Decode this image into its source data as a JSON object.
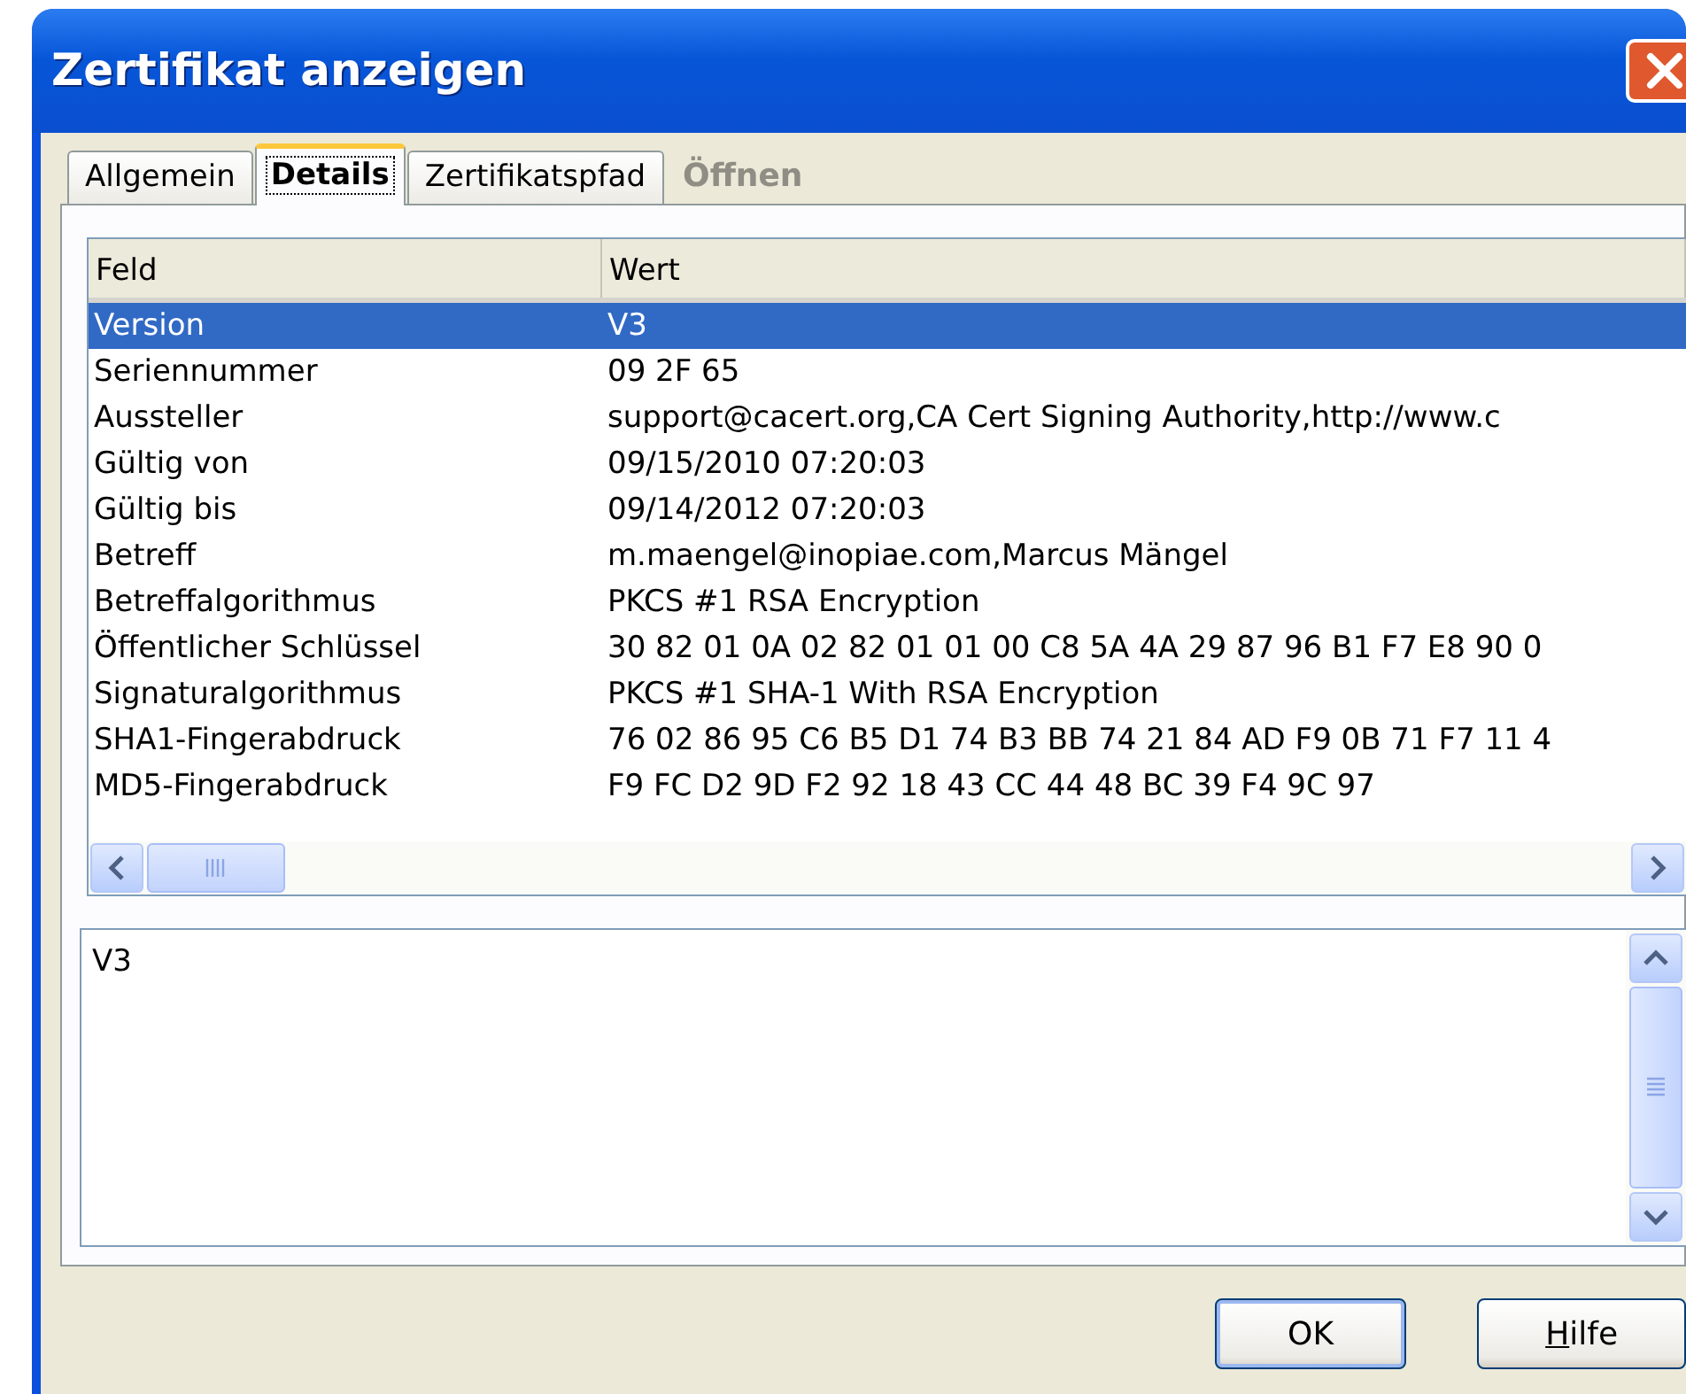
{
  "window": {
    "title": "Zertifikat anzeigen"
  },
  "tabs": [
    {
      "label": "Allgemein",
      "selected": false
    },
    {
      "label": "Details",
      "selected": true
    },
    {
      "label": "Zertifikatspfad",
      "selected": false
    }
  ],
  "ghost_text": "Öffnen",
  "table": {
    "columns": [
      "Feld",
      "Wert"
    ],
    "rows": [
      {
        "field": "Version",
        "value": "V3",
        "selected": true
      },
      {
        "field": "Seriennummer",
        "value": "09 2F 65",
        "selected": false
      },
      {
        "field": "Aussteller",
        "value": "support@cacert.org,CA Cert Signing Authority,http://www.c",
        "selected": false
      },
      {
        "field": "Gültig von",
        "value": "09/15/2010 07:20:03",
        "selected": false
      },
      {
        "field": "Gültig bis",
        "value": "09/14/2012 07:20:03",
        "selected": false
      },
      {
        "field": "Betreff",
        "value": "m.maengel@inopiae.com,Marcus Mängel",
        "selected": false
      },
      {
        "field": "Betreffalgorithmus",
        "value": "PKCS #1 RSA Encryption",
        "selected": false
      },
      {
        "field": "Öffentlicher Schlüssel",
        "value": "30 82 01 0A 02 82 01 01 00 C8 5A 4A 29 87 96 B1 F7 E8 90 0",
        "selected": false
      },
      {
        "field": "Signaturalgorithmus",
        "value": "PKCS #1 SHA-1 With RSA Encryption",
        "selected": false
      },
      {
        "field": "SHA1-Fingerabdruck",
        "value": "76 02 86 95 C6 B5 D1 74 B3 BB 74 21 84 AD F9 0B 71 F7 11 4",
        "selected": false
      },
      {
        "field": "MD5-Fingerabdruck",
        "value": "F9 FC D2 9D F2 92 18 43 CC 44 48 BC 39 F4 9C 97",
        "selected": false
      }
    ]
  },
  "detail_text": "V3",
  "buttons": [
    {
      "label": "OK",
      "default": true,
      "mnemonic_underlined": false
    },
    {
      "label": "Hilfe",
      "default": false,
      "mnemonic_underlined": true
    }
  ]
}
